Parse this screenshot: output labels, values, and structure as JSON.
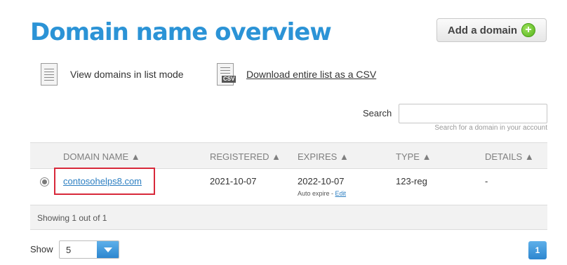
{
  "page_title": "Domain name overview",
  "add_domain": {
    "label": "Add a domain",
    "icon": "plus-circle-icon"
  },
  "actions": {
    "list_mode": "View domains in list mode",
    "csv_download": "Download entire list as a CSV",
    "csv_tag": "CSV"
  },
  "search": {
    "label": "Search",
    "placeholder": "",
    "hint": "Search for a domain in your account"
  },
  "table": {
    "columns": [
      "DOMAIN NAME ▲",
      "REGISTERED ▲",
      "EXPIRES ▲",
      "TYPE ▲",
      "DETAILS ▲"
    ],
    "rows": [
      {
        "domain": "contosohelps8.com",
        "registered": "2021-10-07",
        "expires": "2022-10-07",
        "auto_expire_text": "Auto expire -",
        "edit_label": "Edit",
        "type": "123-reg",
        "details": "-"
      }
    ],
    "showing": "Showing 1 out of 1"
  },
  "pager": {
    "show_label": "Show",
    "show_value": "5",
    "current_page": "1"
  },
  "colors": {
    "title": "#2b93d6",
    "accent_blue": "#2d86cf",
    "highlight_red": "#d8283a",
    "add_green": "#57b41d"
  }
}
